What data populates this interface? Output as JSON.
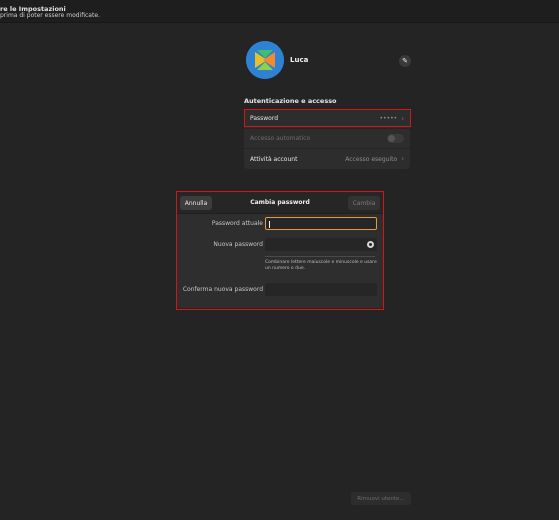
{
  "banner": {
    "title": "re le Impostazioni",
    "subtitle": "prima di poter essere modificate."
  },
  "user": {
    "name": "Luca",
    "edit_icon": "pencil-icon"
  },
  "section": {
    "title": "Autenticazione e accesso"
  },
  "rows": {
    "password": {
      "label": "Password",
      "value": "•••••"
    },
    "auto_login": {
      "label": "Accesso automatico",
      "enabled": false
    },
    "activity": {
      "label": "Attività account",
      "value": "Accesso eseguito"
    }
  },
  "dialog": {
    "cancel": "Annulla",
    "title": "Cambia password",
    "confirm": "Cambia",
    "current_label": "Password attuale",
    "new_label": "Nuova password",
    "hint": "Combinare lettere maiuscole e minuscole e usare un numero o due.",
    "confirm_label": "Conferma nuova password"
  },
  "footer": {
    "remove_user": "Rimuovi utente..."
  },
  "colors": {
    "background": "#242424",
    "highlight": "#d01818",
    "focus": "#e39a43",
    "avatar_bg": "#2f81d4"
  }
}
